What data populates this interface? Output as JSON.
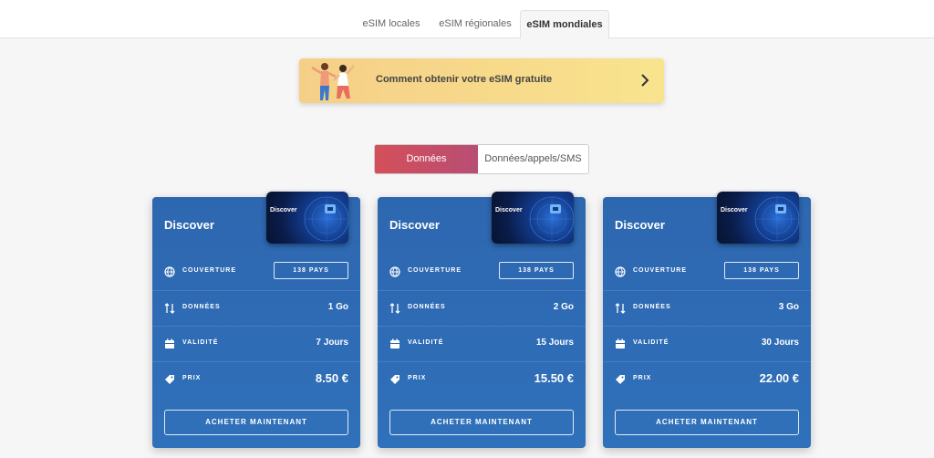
{
  "tabs": [
    {
      "label": "eSIM locales",
      "active": false
    },
    {
      "label": "eSIM régionales",
      "active": false
    },
    {
      "label": "eSIM mondiales",
      "active": true
    }
  ],
  "banner": {
    "text": "Comment obtenir votre eSIM gratuite",
    "icon": "chevron-right-icon"
  },
  "plan_toggle": {
    "options": [
      "Données",
      "Données/appels/SMS"
    ],
    "selected": "Données",
    "active_color": "#d44f5a"
  },
  "row_labels": {
    "coverage": "COUVERTURE",
    "data": "DONNÉES",
    "validity": "VALIDITÉ",
    "price": "PRIX"
  },
  "cards": [
    {
      "title": "Discover",
      "sim_label": "Discover",
      "coverage": "138 PAYS",
      "data": "1 Go",
      "validity": "7 Jours",
      "price": "8.50 €",
      "button": "ACHETER MAINTENANT"
    },
    {
      "title": "Discover",
      "sim_label": "Discover",
      "coverage": "138 PAYS",
      "data": "2 Go",
      "validity": "15 Jours",
      "price": "15.50 €",
      "button": "ACHETER MAINTENANT"
    },
    {
      "title": "Discover",
      "sim_label": "Discover",
      "coverage": "138 PAYS",
      "data": "3 Go",
      "validity": "30 Jours",
      "price": "22.00 €",
      "button": "ACHETER MAINTENANT"
    }
  ],
  "colors": {
    "card_blue": "#2f6cb6",
    "banner_yellow": "#f7d98a"
  }
}
